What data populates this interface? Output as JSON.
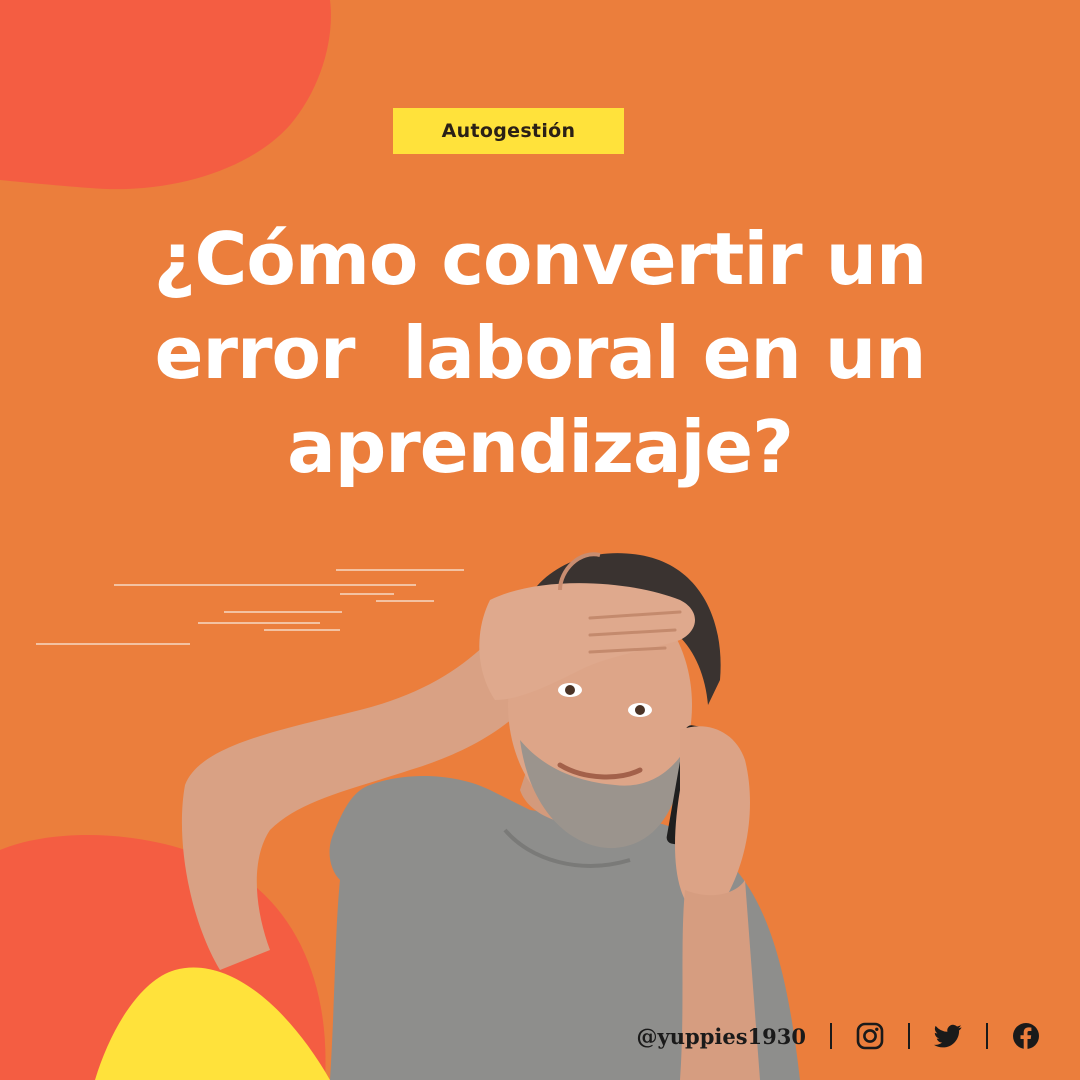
{
  "badge": {
    "label": "Autogestión"
  },
  "headline": {
    "lines": [
      "¿Cómo convertir un",
      "error  laboral en un",
      "aprendizaje?"
    ]
  },
  "footer": {
    "handle": "@yuppies1930",
    "social_icons": [
      "instagram-icon",
      "twitter-icon",
      "facebook-icon"
    ]
  },
  "colors": {
    "background": "#EB7E3C",
    "blob_red": "#F45D42",
    "blob_yellow": "#FFE23B",
    "badge_bg": "#FFE23B",
    "headline_text": "#FFFFFF",
    "footer_text": "#1A1A1A"
  },
  "image": {
    "subject": "man with hand on forehead talking on phone, grey t-shirt"
  }
}
